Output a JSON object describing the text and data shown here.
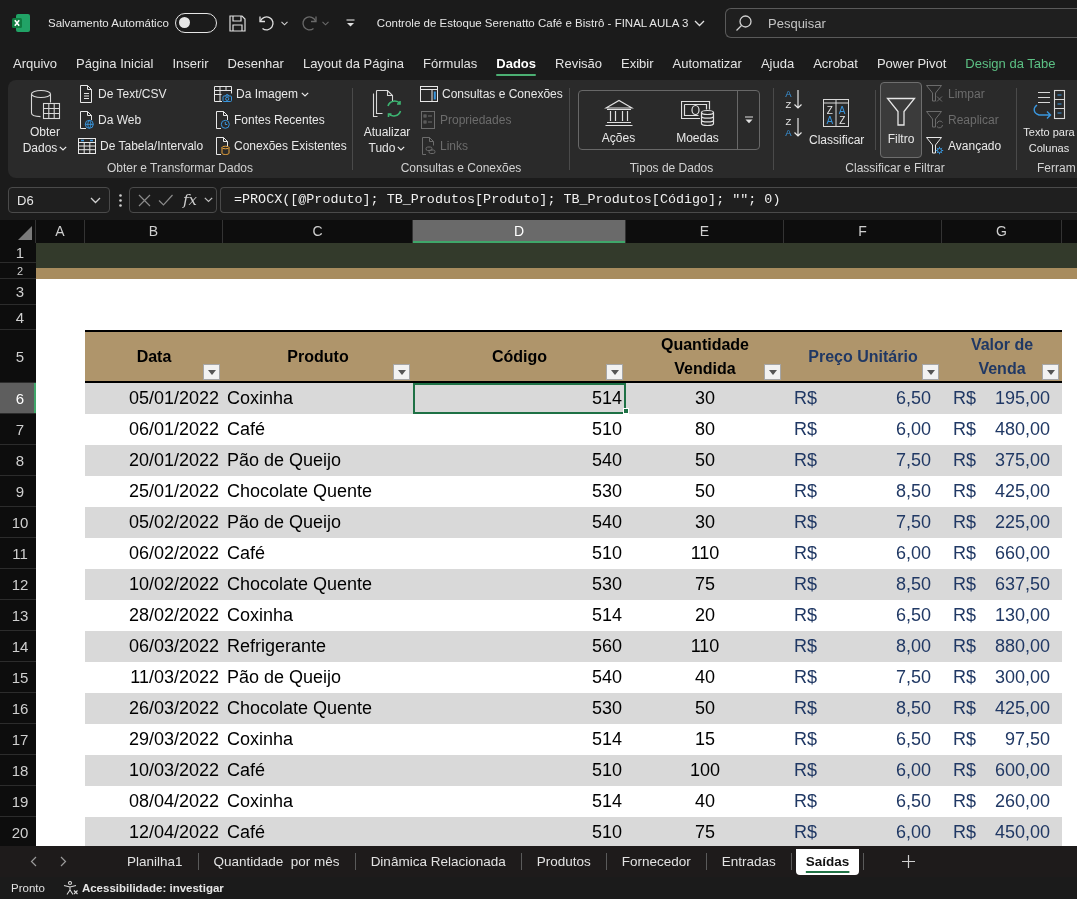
{
  "title_bar": {
    "autosave_label": "Salvamento Automático",
    "autosave_on": false,
    "document_title": "Controle de Estoque Serenatto Café e Bistrô - FINAL AULA 3",
    "search": {
      "placeholder": "Pesquisar"
    }
  },
  "menu_tabs": [
    {
      "label": "Arquivo",
      "selected": false,
      "kind": "standard"
    },
    {
      "label": "Página Inicial",
      "selected": false,
      "kind": "standard"
    },
    {
      "label": "Inserir",
      "selected": false,
      "kind": "standard"
    },
    {
      "label": "Desenhar",
      "selected": false,
      "kind": "standard"
    },
    {
      "label": "Layout da Página",
      "selected": false,
      "kind": "standard"
    },
    {
      "label": "Fórmulas",
      "selected": false,
      "kind": "standard"
    },
    {
      "label": "Dados",
      "selected": true,
      "kind": "standard"
    },
    {
      "label": "Revisão",
      "selected": false,
      "kind": "standard"
    },
    {
      "label": "Exibir",
      "selected": false,
      "kind": "standard"
    },
    {
      "label": "Automatizar",
      "selected": false,
      "kind": "standard"
    },
    {
      "label": "Ajuda",
      "selected": false,
      "kind": "standard"
    },
    {
      "label": "Acrobat",
      "selected": false,
      "kind": "standard"
    },
    {
      "label": "Power Pivot",
      "selected": false,
      "kind": "standard"
    },
    {
      "label": "Design da Tabe",
      "selected": false,
      "kind": "contextual"
    }
  ],
  "ribbon": {
    "groups": [
      {
        "label": "Obter e Transformar Dados",
        "large_buttons": [
          {
            "label": "Obter Dados",
            "dropdown": true,
            "selected": false
          }
        ],
        "small_buttons": [
          {
            "label": "De Text/CSV",
            "dropdown": false,
            "disabled": false
          },
          {
            "label": "Da Web",
            "dropdown": false,
            "disabled": false
          },
          {
            "label": "De Tabela/Intervalo",
            "dropdown": false,
            "disabled": false
          },
          {
            "label": "Da Imagem",
            "dropdown": true,
            "disabled": false
          },
          {
            "label": "Fontes Recentes",
            "dropdown": false,
            "disabled": false
          },
          {
            "label": "Conexões Existentes",
            "dropdown": false,
            "disabled": false
          }
        ]
      },
      {
        "label": "Consultas e Conexões",
        "large_buttons": [
          {
            "label": "Atualizar Tudo",
            "dropdown": true,
            "selected": false
          }
        ],
        "small_buttons": [
          {
            "label": "Consultas e Conexões",
            "dropdown": false,
            "disabled": false
          },
          {
            "label": "Propriedades",
            "dropdown": false,
            "disabled": true
          },
          {
            "label": "Links",
            "dropdown": false,
            "disabled": true
          }
        ]
      },
      {
        "label": "Tipos de Dados",
        "gallery": [
          {
            "label": "Ações"
          },
          {
            "label": "Moedas"
          }
        ]
      },
      {
        "label": "Classificar e Filtrar",
        "sort_buttons": [
          {
            "letters": [
              "A",
              "Z"
            ]
          },
          {
            "letters": [
              "Z",
              "A"
            ]
          }
        ],
        "large_buttons": [
          {
            "label": "Classificar",
            "dropdown": false,
            "selected": false,
            "icon_letters": [
              "Z",
              "A",
              "A",
              "Z"
            ]
          },
          {
            "label": "Filtro",
            "dropdown": false,
            "selected": true
          }
        ],
        "small_buttons": [
          {
            "label": "Limpar",
            "dropdown": false,
            "disabled": true
          },
          {
            "label": "Reaplicar",
            "dropdown": false,
            "disabled": true
          },
          {
            "label": "Avançado",
            "dropdown": false,
            "disabled": false
          }
        ]
      },
      {
        "label": "Ferram",
        "large_buttons": [
          {
            "label": "Texto para Colunas",
            "dropdown": false,
            "selected": false
          }
        ]
      }
    ]
  },
  "formula_bar": {
    "name_box": "D6",
    "function_label": "fx",
    "formula": "=PROCX([@Produto]; TB_Produtos[Produto]; TB_Produtos[Código]; \"\"; 0)"
  },
  "sheet": {
    "columns": [
      {
        "label": "A",
        "selected": false
      },
      {
        "label": "B",
        "selected": false
      },
      {
        "label": "C",
        "selected": false
      },
      {
        "label": "D",
        "selected": true
      },
      {
        "label": "E",
        "selected": false
      },
      {
        "label": "F",
        "selected": false
      },
      {
        "label": "G",
        "selected": false
      }
    ],
    "row_headers": [
      {
        "label": "1",
        "selected": false
      },
      {
        "label": "2",
        "selected": false
      },
      {
        "label": "3",
        "selected": false
      },
      {
        "label": "4",
        "selected": false
      },
      {
        "label": "5",
        "selected": false
      },
      {
        "label": "6",
        "selected": true
      },
      {
        "label": "7",
        "selected": false
      },
      {
        "label": "8",
        "selected": false
      },
      {
        "label": "9",
        "selected": false
      },
      {
        "label": "10",
        "selected": false
      },
      {
        "label": "11",
        "selected": false
      },
      {
        "label": "12",
        "selected": false
      },
      {
        "label": "13",
        "selected": false
      },
      {
        "label": "14",
        "selected": false
      },
      {
        "label": "15",
        "selected": false
      },
      {
        "label": "16",
        "selected": false
      },
      {
        "label": "17",
        "selected": false
      },
      {
        "label": "18",
        "selected": false
      },
      {
        "label": "19",
        "selected": false
      },
      {
        "label": "20",
        "selected": false
      }
    ],
    "table": {
      "columns": [
        {
          "label": "Data",
          "kind": "plain"
        },
        {
          "label": "Produto",
          "kind": "plain"
        },
        {
          "label": "Código",
          "kind": "plain"
        },
        {
          "label": "Quantidade Vendida",
          "kind": "plain"
        },
        {
          "label": "Preço Unitário",
          "kind": "currency"
        },
        {
          "label": "Valor de Venda",
          "kind": "currency"
        }
      ],
      "rows": [
        {
          "date": "05/01/2022",
          "product": "Coxinha",
          "code": "514",
          "quantity": "30",
          "unit_price": {
            "currency": "R$",
            "amount": "6,50"
          },
          "total": {
            "currency": "R$",
            "amount": "195,00"
          }
        },
        {
          "date": "06/01/2022",
          "product": "Café",
          "code": "510",
          "quantity": "80",
          "unit_price": {
            "currency": "R$",
            "amount": "6,00"
          },
          "total": {
            "currency": "R$",
            "amount": "480,00"
          }
        },
        {
          "date": "20/01/2022",
          "product": "Pão de Queijo",
          "code": "540",
          "quantity": "50",
          "unit_price": {
            "currency": "R$",
            "amount": "7,50"
          },
          "total": {
            "currency": "R$",
            "amount": "375,00"
          }
        },
        {
          "date": "25/01/2022",
          "product": "Chocolate Quente",
          "code": "530",
          "quantity": "50",
          "unit_price": {
            "currency": "R$",
            "amount": "8,50"
          },
          "total": {
            "currency": "R$",
            "amount": "425,00"
          }
        },
        {
          "date": "05/02/2022",
          "product": "Pão de Queijo",
          "code": "540",
          "quantity": "30",
          "unit_price": {
            "currency": "R$",
            "amount": "7,50"
          },
          "total": {
            "currency": "R$",
            "amount": "225,00"
          }
        },
        {
          "date": "06/02/2022",
          "product": "Café",
          "code": "510",
          "quantity": "110",
          "unit_price": {
            "currency": "R$",
            "amount": "6,00"
          },
          "total": {
            "currency": "R$",
            "amount": "660,00"
          }
        },
        {
          "date": "10/02/2022",
          "product": "Chocolate Quente",
          "code": "530",
          "quantity": "75",
          "unit_price": {
            "currency": "R$",
            "amount": "8,50"
          },
          "total": {
            "currency": "R$",
            "amount": "637,50"
          }
        },
        {
          "date": "28/02/2022",
          "product": "Coxinha",
          "code": "514",
          "quantity": "20",
          "unit_price": {
            "currency": "R$",
            "amount": "6,50"
          },
          "total": {
            "currency": "R$",
            "amount": "130,00"
          }
        },
        {
          "date": "06/03/2022",
          "product": "Refrigerante",
          "code": "560",
          "quantity": "110",
          "unit_price": {
            "currency": "R$",
            "amount": "8,00"
          },
          "total": {
            "currency": "R$",
            "amount": "880,00"
          }
        },
        {
          "date": "11/03/2022",
          "product": "Pão de Queijo",
          "code": "540",
          "quantity": "40",
          "unit_price": {
            "currency": "R$",
            "amount": "7,50"
          },
          "total": {
            "currency": "R$",
            "amount": "300,00"
          }
        },
        {
          "date": "26/03/2022",
          "product": "Chocolate Quente",
          "code": "530",
          "quantity": "50",
          "unit_price": {
            "currency": "R$",
            "amount": "8,50"
          },
          "total": {
            "currency": "R$",
            "amount": "425,00"
          }
        },
        {
          "date": "29/03/2022",
          "product": "Coxinha",
          "code": "514",
          "quantity": "15",
          "unit_price": {
            "currency": "R$",
            "amount": "6,50"
          },
          "total": {
            "currency": "R$",
            "amount": "97,50"
          }
        },
        {
          "date": "10/03/2022",
          "product": "Café",
          "code": "510",
          "quantity": "100",
          "unit_price": {
            "currency": "R$",
            "amount": "6,00"
          },
          "total": {
            "currency": "R$",
            "amount": "600,00"
          }
        },
        {
          "date": "08/04/2022",
          "product": "Coxinha",
          "code": "514",
          "quantity": "40",
          "unit_price": {
            "currency": "R$",
            "amount": "6,50"
          },
          "total": {
            "currency": "R$",
            "amount": "260,00"
          }
        },
        {
          "date": "12/04/2022",
          "product": "Café",
          "code": "510",
          "quantity": "75",
          "unit_price": {
            "currency": "R$",
            "amount": "6,00"
          },
          "total": {
            "currency": "R$",
            "amount": "450,00"
          }
        }
      ]
    }
  },
  "sheet_tabs": [
    {
      "label": "Planilha1",
      "selected": false
    },
    {
      "label": "Quantidade  por mês",
      "selected": false
    },
    {
      "label": "Dinâmica Relacionada",
      "selected": false
    },
    {
      "label": "Produtos",
      "selected": false
    },
    {
      "label": "Fornecedor",
      "selected": false
    },
    {
      "label": "Entradas",
      "selected": false
    },
    {
      "label": "Saídas",
      "selected": true
    }
  ],
  "status_bar": {
    "mode": "Pronto",
    "accessibility": "Acessibilidade: investigar"
  }
}
